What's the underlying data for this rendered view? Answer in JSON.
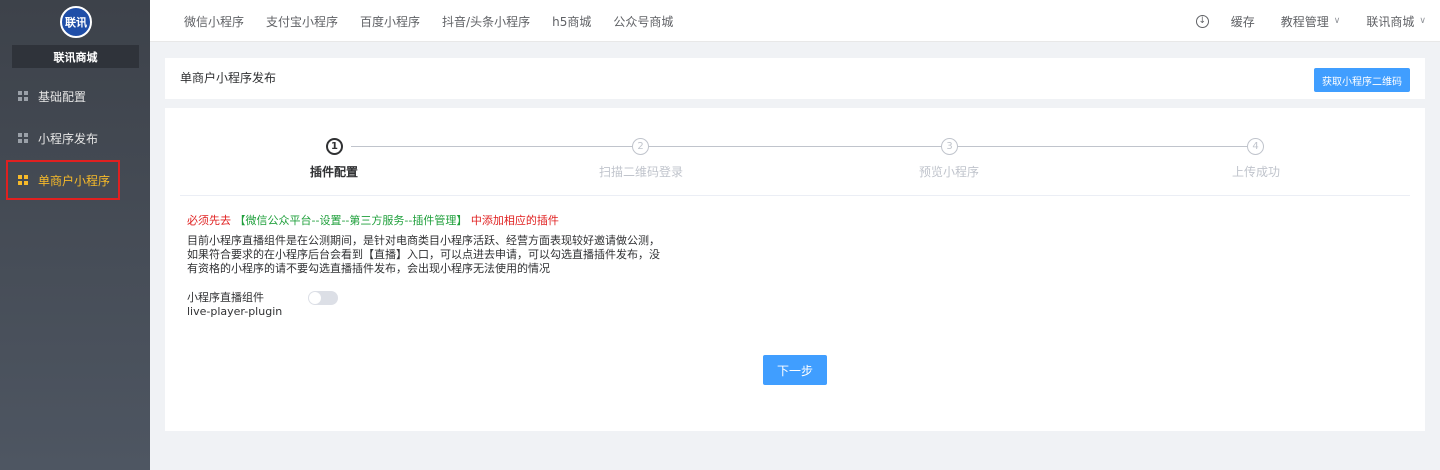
{
  "sidebar": {
    "logo_text": "联讯",
    "shop_name": "联讯商城",
    "items": [
      {
        "label": "基础配置",
        "active": false
      },
      {
        "label": "小程序发布",
        "active": false
      },
      {
        "label": "单商户小程序",
        "active": true
      }
    ]
  },
  "topbar": {
    "tabs": [
      "微信小程序",
      "支付宝小程序",
      "百度小程序",
      "抖音/头条小程序",
      "h5商城",
      "公众号商城"
    ],
    "cache_label": "缓存",
    "tutorial_label": "教程管理",
    "account_label": "联讯商城"
  },
  "header": {
    "title": "单商户小程序发布",
    "qr_button_label": "获取小程序二维码"
  },
  "steps": [
    {
      "number": "1",
      "label": "插件配置",
      "active": true
    },
    {
      "number": "2",
      "label": "扫描二维码登录",
      "active": false
    },
    {
      "number": "3",
      "label": "预览小程序",
      "active": false
    },
    {
      "number": "4",
      "label": "上传成功",
      "active": false
    }
  ],
  "content": {
    "notice_prefix": "必须先去",
    "notice_path": "【微信公众平台--设置--第三方服务--插件管理】",
    "notice_suffix": "中添加相应的插件",
    "description": "目前小程序直播组件是在公测期间，是针对电商类目小程序活跃、经营方面表现较好邀请做公测，如果符合要求的在小程序后台会看到【直播】入口，可以点进去申请，可以勾选直播插件发布，没有资格的小程序的请不要勾选直播插件发布，会出现小程序无法使用的情况",
    "plugin_label": "小程序直播组件",
    "plugin_id": "live-player-plugin",
    "plugin_enabled": false,
    "next_button_label": "下一步"
  },
  "colors": {
    "accent": "#409eff",
    "active_menu": "#f7ba2a",
    "notice_red": "#e02020",
    "notice_green": "#20a03c"
  }
}
